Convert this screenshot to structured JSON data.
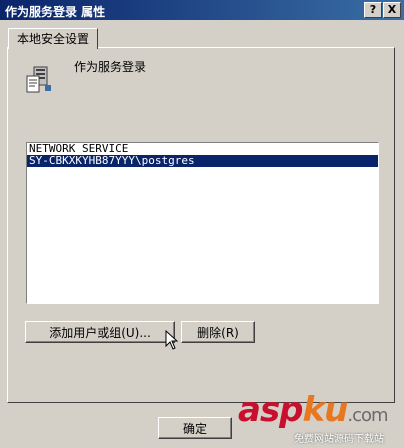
{
  "window": {
    "title": "作为服务登录 属性",
    "help_label": "?",
    "close_label": "X"
  },
  "tabs": [
    {
      "label": "本地安全设置"
    }
  ],
  "policy": {
    "title": "作为服务登录",
    "icon": "policy-server-icon"
  },
  "accounts_list": {
    "items": [
      {
        "label": "NETWORK SERVICE",
        "selected": false
      },
      {
        "label": "SY-CBKXKYHB87YYY\\postgres",
        "selected": true
      }
    ]
  },
  "actions": {
    "add_label": "添加用户或组(U)...",
    "remove_label": "删除(R)"
  },
  "footer": {
    "ok_label": "确定"
  },
  "watermark": {
    "brand_asp": "asp",
    "brand_ku": "ku",
    "brand_com": ".com",
    "subtitle": "免费网站源码下载站"
  }
}
